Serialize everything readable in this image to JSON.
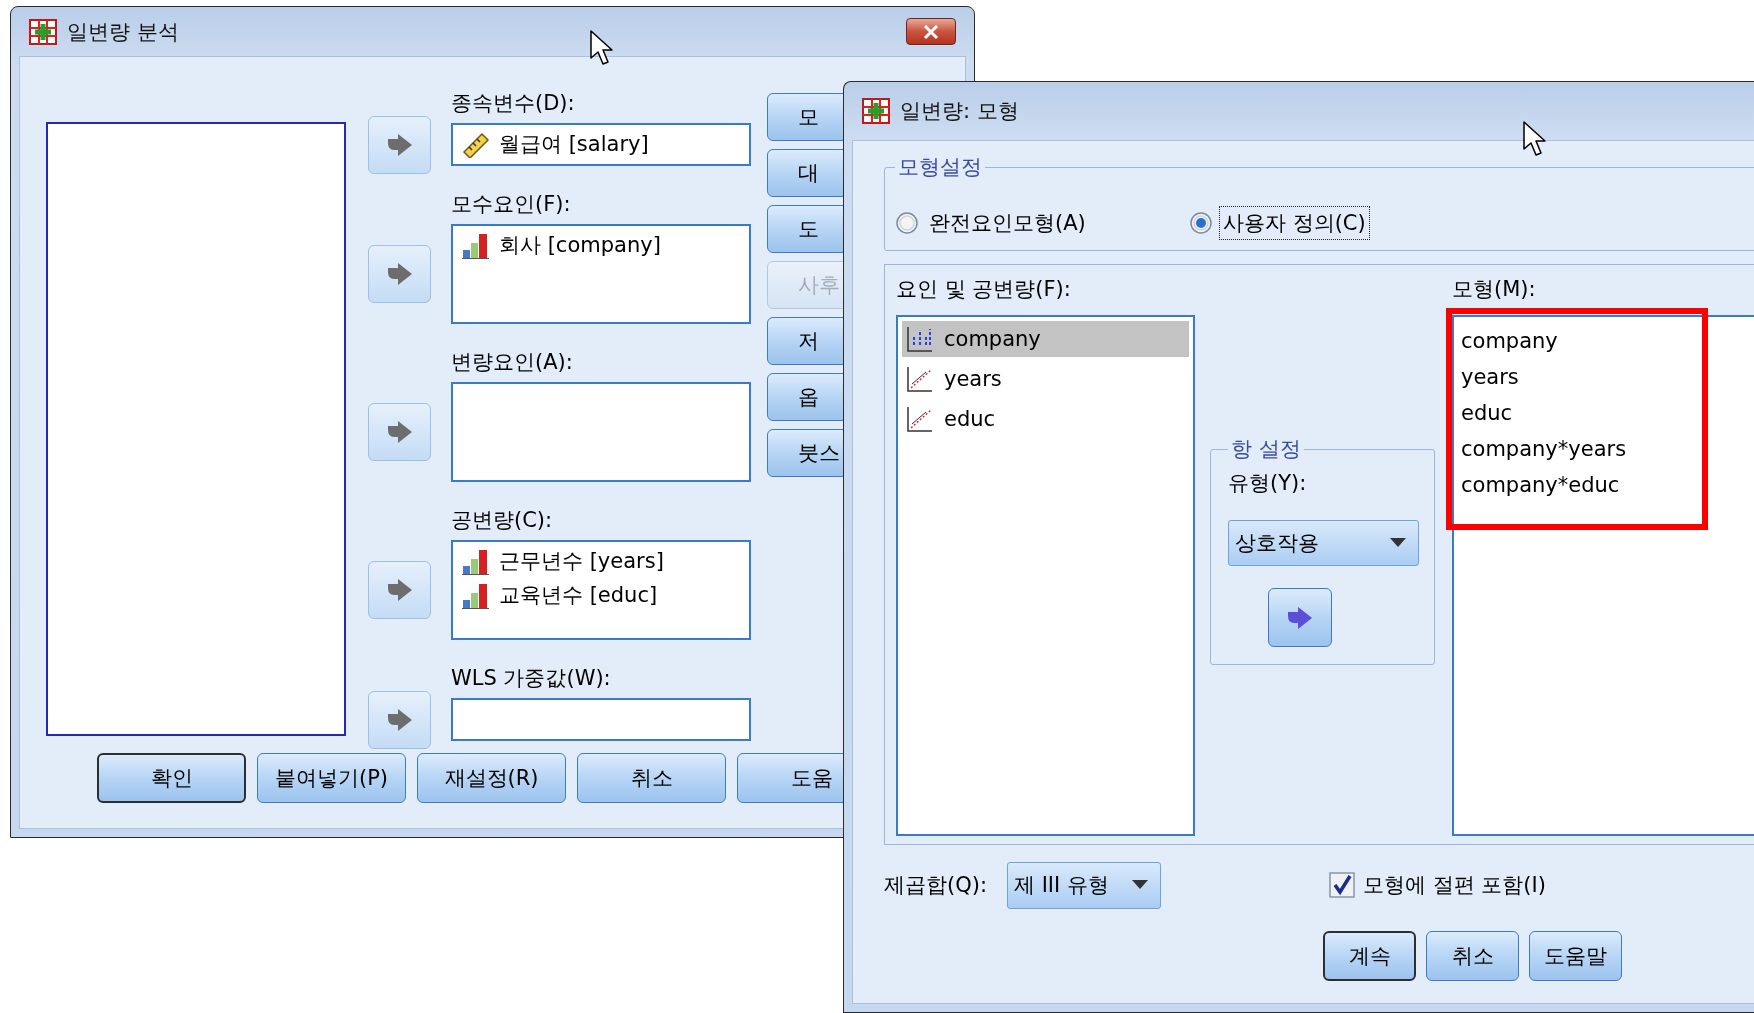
{
  "main_dialog": {
    "title": "일변량 분석",
    "targets": [
      {
        "label": "종속변수(D):",
        "kind": "single",
        "items": [
          {
            "name": "월급여 [salary]",
            "kind": "scale"
          }
        ]
      },
      {
        "label": "모수요인(F):",
        "kind": "list",
        "items": [
          {
            "name": "회사 [company]",
            "kind": "ordinal"
          }
        ]
      },
      {
        "label": "변량요인(A):",
        "kind": "list"
      },
      {
        "label": "공변량(C):",
        "kind": "list",
        "items": [
          {
            "name": "근무년수 [years]",
            "kind": "ordinal"
          },
          {
            "name": "교육년수 [educ]",
            "kind": "ordinal"
          }
        ]
      },
      {
        "label": "WLS 가중값(W):",
        "kind": "single"
      }
    ],
    "side_buttons": [
      {
        "label": "모",
        "disabled": false
      },
      {
        "label": "대",
        "disabled": false
      },
      {
        "label": "도",
        "disabled": false
      },
      {
        "label": "사후",
        "disabled": true
      },
      {
        "label": "저",
        "disabled": false
      },
      {
        "label": "옵",
        "disabled": false
      },
      {
        "label": "붓스",
        "disabled": false
      }
    ],
    "buttons": [
      {
        "label": "확인",
        "default": true
      },
      {
        "label": "붙여넣기(P)",
        "default": false
      },
      {
        "label": "재설정(R)",
        "default": false
      },
      {
        "label": "취소",
        "default": false
      },
      {
        "label": "도움",
        "default": false
      }
    ]
  },
  "model_dialog": {
    "title": "일변량: 모형",
    "model_setting": {
      "title": "모형설정",
      "options": [
        {
          "label": "완전요인모형(A)",
          "selected": false,
          "focused": false
        },
        {
          "label": "사용자 정의(C)",
          "selected": true,
          "focused": true
        }
      ]
    },
    "factors": {
      "label": "요인 및 공변량(F):",
      "items": [
        {
          "name": "company",
          "kind": "factor",
          "selected": true
        },
        {
          "name": "years",
          "kind": "covariate",
          "selected": false
        },
        {
          "name": "educ",
          "kind": "covariate",
          "selected": false
        }
      ]
    },
    "build_term": {
      "title": "항 설정",
      "type_label": "유형(Y):",
      "type_value": "상호작용"
    },
    "model": {
      "label": "모형(M):",
      "highlighted": true,
      "terms": [
        "company",
        "years",
        "educ",
        "company*years",
        "company*educ"
      ]
    },
    "sum_of_squares": {
      "label": "제곱합(Q):",
      "value": "제 III 유형"
    },
    "include_intercept": {
      "label": "모형에 절편 포함(I)",
      "checked": true
    },
    "buttons": [
      {
        "label": "계속",
        "default": true
      },
      {
        "label": "취소",
        "default": false
      },
      {
        "label": "도움말",
        "default": false
      }
    ]
  }
}
